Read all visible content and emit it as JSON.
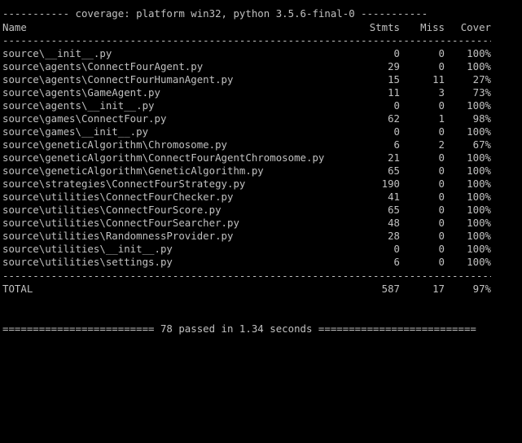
{
  "console": {
    "title_line": "----------- coverage: platform win32, python 3.5.6-final-0 -----------",
    "headers": {
      "name": "Name",
      "stmts": "Stmts",
      "miss": "Miss",
      "cover": "Cover"
    },
    "rows": [
      {
        "name": "source\\__init__.py",
        "stmts": "0",
        "miss": "0",
        "cover": "100%"
      },
      {
        "name": "source\\agents\\ConnectFourAgent.py",
        "stmts": "29",
        "miss": "0",
        "cover": "100%"
      },
      {
        "name": "source\\agents\\ConnectFourHumanAgent.py",
        "stmts": "15",
        "miss": "11",
        "cover": "27%"
      },
      {
        "name": "source\\agents\\GameAgent.py",
        "stmts": "11",
        "miss": "3",
        "cover": "73%"
      },
      {
        "name": "source\\agents\\__init__.py",
        "stmts": "0",
        "miss": "0",
        "cover": "100%"
      },
      {
        "name": "source\\games\\ConnectFour.py",
        "stmts": "62",
        "miss": "1",
        "cover": "98%"
      },
      {
        "name": "source\\games\\__init__.py",
        "stmts": "0",
        "miss": "0",
        "cover": "100%"
      },
      {
        "name": "source\\geneticAlgorithm\\Chromosome.py",
        "stmts": "6",
        "miss": "2",
        "cover": "67%"
      },
      {
        "name": "source\\geneticAlgorithm\\ConnectFourAgentChromosome.py",
        "stmts": "21",
        "miss": "0",
        "cover": "100%"
      },
      {
        "name": "source\\geneticAlgorithm\\GeneticAlgorithm.py",
        "stmts": "65",
        "miss": "0",
        "cover": "100%"
      },
      {
        "name": "source\\strategies\\ConnectFourStrategy.py",
        "stmts": "190",
        "miss": "0",
        "cover": "100%"
      },
      {
        "name": "source\\utilities\\ConnectFourChecker.py",
        "stmts": "41",
        "miss": "0",
        "cover": "100%"
      },
      {
        "name": "source\\utilities\\ConnectFourScore.py",
        "stmts": "65",
        "miss": "0",
        "cover": "100%"
      },
      {
        "name": "source\\utilities\\ConnectFourSearcher.py",
        "stmts": "48",
        "miss": "0",
        "cover": "100%"
      },
      {
        "name": "source\\utilities\\RandomnessProvider.py",
        "stmts": "28",
        "miss": "0",
        "cover": "100%"
      },
      {
        "name": "source\\utilities\\__init__.py",
        "stmts": "0",
        "miss": "0",
        "cover": "100%"
      },
      {
        "name": "source\\utilities\\settings.py",
        "stmts": "6",
        "miss": "0",
        "cover": "100%"
      }
    ],
    "total": {
      "name": "TOTAL",
      "stmts": "587",
      "miss": "17",
      "cover": "97%"
    },
    "separator": "---------------------------------------------------------------------------------------------------",
    "summary_line": "========================= 78 passed in 1.34 seconds =========================="
  },
  "colors": {
    "background": "#000000",
    "text": "#c0c0c0"
  }
}
